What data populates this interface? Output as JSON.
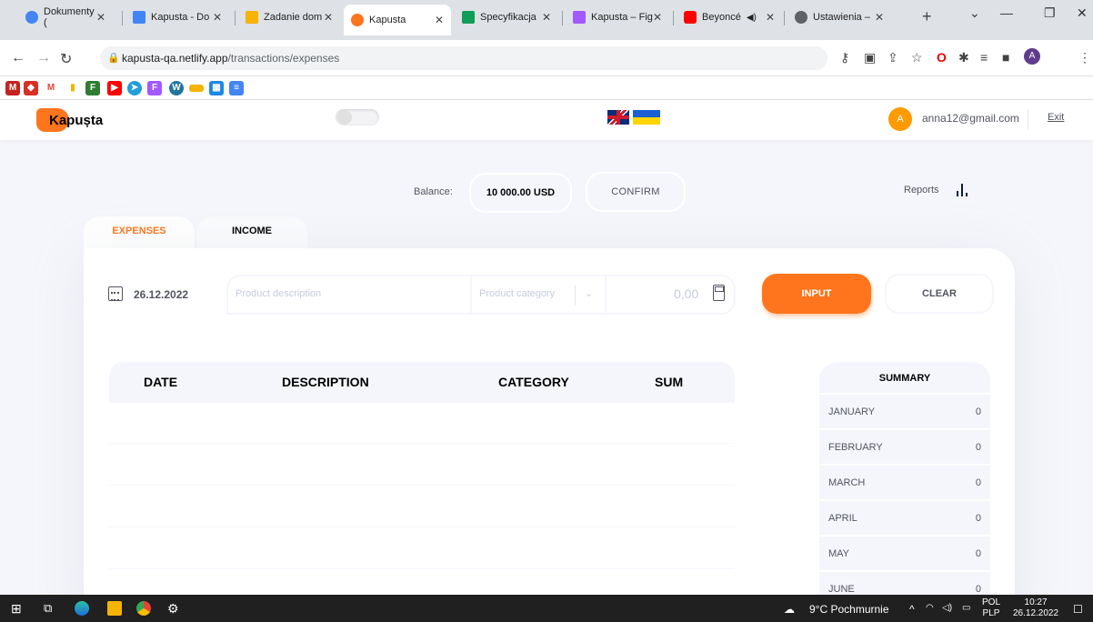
{
  "browser": {
    "tabs": [
      {
        "title": "Dokumenty (",
        "active": false,
        "color": "#4285f4"
      },
      {
        "title": "Kapusta - Do",
        "active": false,
        "color": "#4285f4"
      },
      {
        "title": "Zadanie dom",
        "active": false,
        "color": "#f4b400"
      },
      {
        "title": "Kapusta",
        "active": true,
        "color": "#ff751d"
      },
      {
        "title": "Specyfikacja",
        "active": false,
        "color": "#0f9d58"
      },
      {
        "title": "Kapusta – Fig",
        "active": false,
        "color": "#a259ff"
      },
      {
        "title": "Beyoncé",
        "active": false,
        "color": "#ff0000"
      },
      {
        "title": "Ustawienia –",
        "active": false,
        "color": "#5f6368"
      }
    ],
    "url_host": "kapusta-qa.netlify.app",
    "url_path": "/transactions/expenses",
    "profile_initial": "A"
  },
  "app": {
    "logo": "Kapușta",
    "user_initial": "A",
    "email": "anna12@gmail.com",
    "exit_label": "Exit",
    "balance_label": "Balance:",
    "balance_value": "10 000.00 USD",
    "confirm_label": "CONFIRM",
    "reports_label": "Reports",
    "tabs": {
      "expenses": "EXPENSES",
      "income": "INCOME"
    },
    "date": "26.12.2022",
    "product_description_placeholder": "Product description",
    "product_category_placeholder": "Product category",
    "amount_placeholder": "0,00",
    "input_label": "INPUT",
    "clear_label": "CLEAR",
    "table_headers": {
      "date": "DATE",
      "description": "DESCRIPTION",
      "category": "CATEGORY",
      "sum": "SUM"
    },
    "summary_title": "SUMMARY",
    "summary": [
      {
        "month": "JANUARY",
        "value": "0"
      },
      {
        "month": "FEBRUARY",
        "value": "0"
      },
      {
        "month": "MARCH",
        "value": "0"
      },
      {
        "month": "APRIL",
        "value": "0"
      },
      {
        "month": "MAY",
        "value": "0"
      },
      {
        "month": "JUNE",
        "value": "0"
      }
    ],
    "accent_color": "#ff751d"
  },
  "taskbar": {
    "weather": "9°C Pochmurnie",
    "lang_top": "POL",
    "lang_bottom": "PLP",
    "time": "10:27",
    "date": "26.12.2022"
  }
}
